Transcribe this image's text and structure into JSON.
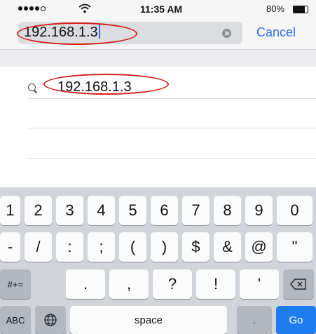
{
  "status_bar": {
    "time": "11:35 AM",
    "battery": "80%"
  },
  "search": {
    "query": "192.168.1.3",
    "cancel_label": "Cancel"
  },
  "results": [
    {
      "text": "192.168.1.3"
    }
  ],
  "keyboard": {
    "row1": [
      "1",
      "2",
      "3",
      "4",
      "5",
      "6",
      "7",
      "8",
      "9",
      "0"
    ],
    "row2": [
      "-",
      "/",
      ":",
      ";",
      "(",
      ")",
      "$",
      "&",
      "@",
      "\""
    ],
    "row3_left": "#+=",
    "row3": [
      ".",
      ",",
      "?",
      "!",
      "'"
    ],
    "row4": {
      "abc": "ABC",
      "space": "space",
      "period": ".",
      "go": "Go"
    }
  },
  "colors": {
    "accent": "#2a6df4",
    "go_key": "#1e7bf0",
    "annotation": "#d21f1f"
  }
}
